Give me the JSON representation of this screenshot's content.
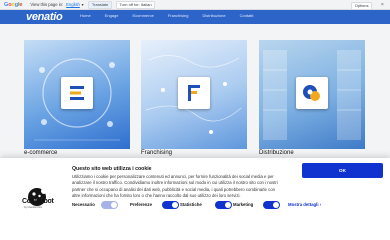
{
  "translate_bar": {
    "view_label": "View this page in:",
    "language": "English",
    "translate_button": "Translate",
    "turn_off_button": "Turn off for: Italian",
    "options_button": "Options",
    "close_symbol": "×"
  },
  "site": {
    "brand": "venatio",
    "nav": [
      "Home",
      "Engage",
      "Ecommerce",
      "Franchising",
      "Distribuzione",
      "Contatti"
    ]
  },
  "cards": [
    {
      "title": "e-commerce"
    },
    {
      "title": "Franchising"
    },
    {
      "title": "Distribuzione"
    }
  ],
  "cookie_banner": {
    "heading": "Questo sito web utilizza i cookie",
    "body": "Utilizziamo i cookie per personalizzare contenuti ed annunci, per fornire funzionalità dei social media e per analizzare il nostro traffico. Condividiamo inoltre informazioni sul modo in cui utilizza il nostro sito con i nostri partner che si occupano di analisi dei dati web, pubblicità e social media, i quali potrebbero combinarle con altre informazioni che ha fornito loro o che hanno raccolto dal suo utilizzo dei loro servizi.",
    "ok_button": "OK",
    "logo_text": "Cookiebot",
    "logo_subtext": "by Usercentrics",
    "preferences": [
      {
        "label": "Necessario",
        "enabled": true,
        "locked": true
      },
      {
        "label": "Preferenze",
        "enabled": true,
        "locked": false
      },
      {
        "label": "Statistiche",
        "enabled": true,
        "locked": false
      },
      {
        "label": "Marketing",
        "enabled": true,
        "locked": false
      }
    ],
    "details_link": "Mostra dettagli",
    "details_chevron": "›"
  }
}
